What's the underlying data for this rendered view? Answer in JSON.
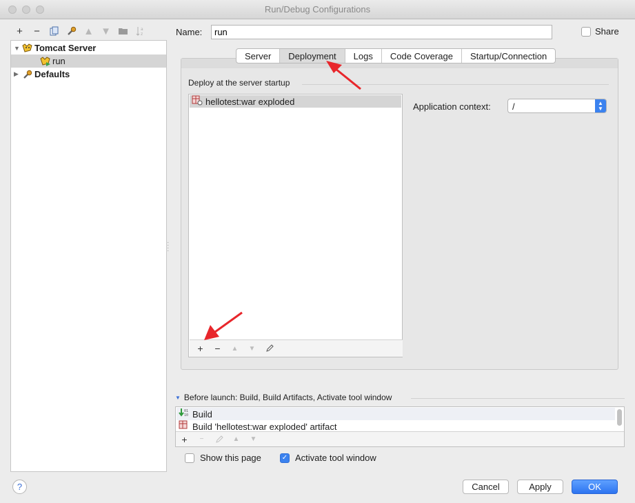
{
  "window": {
    "title": "Run/Debug Configurations"
  },
  "left_toolbar": {
    "buttons": [
      "+",
      "−"
    ]
  },
  "tree": {
    "items": [
      {
        "label": "Tomcat Server",
        "icon": "tomcat-icon"
      },
      {
        "label": "run",
        "icon": "tomcat-run-icon"
      },
      {
        "label": "Defaults",
        "icon": "wrench-icon"
      }
    ]
  },
  "name": {
    "label": "Name:",
    "value": "run"
  },
  "share": {
    "label": "Share",
    "checked": false
  },
  "tabs": [
    "Server",
    "Deployment",
    "Logs",
    "Code Coverage",
    "Startup/Connection"
  ],
  "active_tab": "Deployment",
  "deploy": {
    "section_label": "Deploy at the server startup",
    "artifacts": [
      "hellotest:war exploded"
    ],
    "toolbar": {
      "add": "+",
      "remove": "−"
    }
  },
  "context": {
    "label": "Application context:",
    "value": "/"
  },
  "before_launch": {
    "header": "Before launch: Build, Build Artifacts, Activate tool window",
    "items": [
      "Build",
      "Build 'hellotest:war exploded' artifact"
    ],
    "toolbar": {
      "add": "+"
    }
  },
  "options": {
    "show_this_page": {
      "label": "Show this page",
      "checked": false
    },
    "activate_tool_window": {
      "label": "Activate tool window",
      "checked": true
    }
  },
  "buttons": {
    "help": "?",
    "cancel": "Cancel",
    "apply": "Apply",
    "ok": "OK"
  },
  "colors": {
    "accent": "#3b82ef",
    "annotation_arrow": "#e8262b"
  }
}
